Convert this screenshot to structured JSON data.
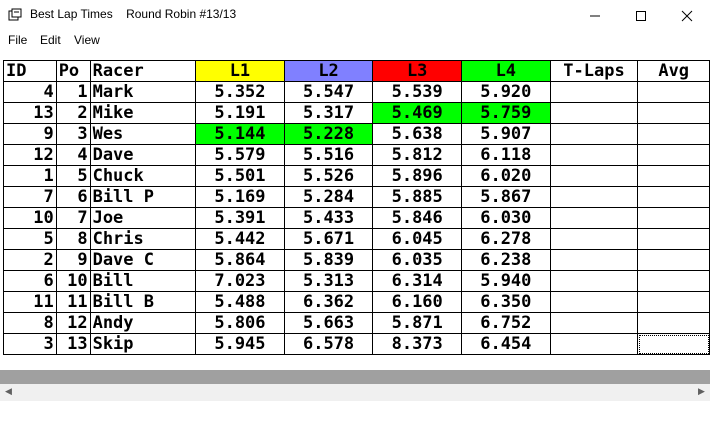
{
  "window": {
    "title": "Best Lap Times",
    "subtitle": "Round Robin #13/13"
  },
  "menu": {
    "file": "File",
    "edit": "Edit",
    "view": "View"
  },
  "table": {
    "headers": [
      "ID",
      "Po",
      "Racer",
      "L1",
      "L2",
      "L3",
      "L4",
      "T-Laps",
      "Avg"
    ],
    "lane_colors": [
      "#ffff00",
      "#8080ff",
      "#ff0000",
      "#00ff00"
    ],
    "highlight_color": "#00ff00",
    "rows": [
      {
        "id": "4",
        "pos": "1",
        "racer": "Mark",
        "l1": "5.352",
        "l2": "5.547",
        "l3": "5.539",
        "l4": "5.920",
        "tlaps": "",
        "avg": "",
        "hl": []
      },
      {
        "id": "13",
        "pos": "2",
        "racer": "Mike",
        "l1": "5.191",
        "l2": "5.317",
        "l3": "5.469",
        "l4": "5.759",
        "tlaps": "",
        "avg": "",
        "hl": [
          "l3",
          "l4"
        ]
      },
      {
        "id": "9",
        "pos": "3",
        "racer": "Wes",
        "l1": "5.144",
        "l2": "5.228",
        "l3": "5.638",
        "l4": "5.907",
        "tlaps": "",
        "avg": "",
        "hl": [
          "l1",
          "l2"
        ]
      },
      {
        "id": "12",
        "pos": "4",
        "racer": "Dave",
        "l1": "5.579",
        "l2": "5.516",
        "l3": "5.812",
        "l4": "6.118",
        "tlaps": "",
        "avg": "",
        "hl": []
      },
      {
        "id": "1",
        "pos": "5",
        "racer": "Chuck",
        "l1": "5.501",
        "l2": "5.526",
        "l3": "5.896",
        "l4": "6.020",
        "tlaps": "",
        "avg": "",
        "hl": []
      },
      {
        "id": "7",
        "pos": "6",
        "racer": "Bill P",
        "l1": "5.169",
        "l2": "5.284",
        "l3": "5.885",
        "l4": "5.867",
        "tlaps": "",
        "avg": "",
        "hl": []
      },
      {
        "id": "10",
        "pos": "7",
        "racer": "Joe",
        "l1": "5.391",
        "l2": "5.433",
        "l3": "5.846",
        "l4": "6.030",
        "tlaps": "",
        "avg": "",
        "hl": []
      },
      {
        "id": "5",
        "pos": "8",
        "racer": "Chris",
        "l1": "5.442",
        "l2": "5.671",
        "l3": "6.045",
        "l4": "6.278",
        "tlaps": "",
        "avg": "",
        "hl": []
      },
      {
        "id": "2",
        "pos": "9",
        "racer": "Dave C",
        "l1": "5.864",
        "l2": "5.839",
        "l3": "6.035",
        "l4": "6.238",
        "tlaps": "",
        "avg": "",
        "hl": []
      },
      {
        "id": "6",
        "pos": "10",
        "racer": "Bill",
        "l1": "7.023",
        "l2": "5.313",
        "l3": "6.314",
        "l4": "5.940",
        "tlaps": "",
        "avg": "",
        "hl": []
      },
      {
        "id": "11",
        "pos": "11",
        "racer": "Bill B",
        "l1": "5.488",
        "l2": "6.362",
        "l3": "6.160",
        "l4": "6.350",
        "tlaps": "",
        "avg": "",
        "hl": []
      },
      {
        "id": "8",
        "pos": "12",
        "racer": "Andy",
        "l1": "5.806",
        "l2": "5.663",
        "l3": "5.871",
        "l4": "6.752",
        "tlaps": "",
        "avg": "",
        "hl": []
      },
      {
        "id": "3",
        "pos": "13",
        "racer": "Skip",
        "l1": "5.945",
        "l2": "6.578",
        "l3": "8.373",
        "l4": "6.454",
        "tlaps": "",
        "avg": "",
        "hl": []
      }
    ]
  },
  "scrollbar": {
    "left_arrow": "◀",
    "right_arrow": "▶"
  }
}
